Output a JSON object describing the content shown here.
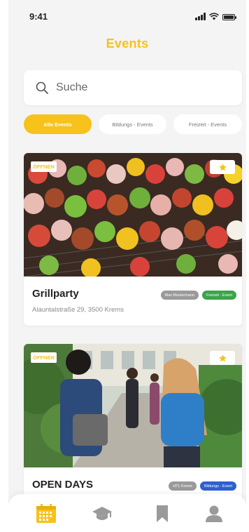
{
  "status": {
    "time": "9:41"
  },
  "header": {
    "title": "Events"
  },
  "search": {
    "placeholder": "Suche"
  },
  "filters": [
    {
      "label": "Alle Events",
      "active": true
    },
    {
      "label": "Bildungs - Events",
      "active": false
    },
    {
      "label": "Freizeit - Events",
      "active": false
    }
  ],
  "events": [
    {
      "status_label": "ÖFFNEN",
      "title": "Grillparty",
      "address": "Alauntalstraße 29, 3500 Krems",
      "tags": [
        {
          "label": "Max Mustermann",
          "color": "#9a9a9a"
        },
        {
          "label": "Freizeit - Event",
          "color": "#3aa54a"
        }
      ]
    },
    {
      "status_label": "ÖFFNEN",
      "title": "OPEN DAYS",
      "tags": [
        {
          "label": "HTL Krems",
          "color": "#9a9a9a"
        },
        {
          "label": "Bildungs - Event",
          "color": "#2f5fd0"
        }
      ]
    }
  ],
  "nav": [
    {
      "icon": "calendar-icon",
      "active": true
    },
    {
      "icon": "graduation-cap-icon",
      "active": false
    },
    {
      "icon": "bookmark-icon",
      "active": false
    },
    {
      "icon": "user-icon",
      "active": false
    }
  ],
  "colors": {
    "accent": "#f6c21b",
    "inactive_icon": "#9a9a9a"
  }
}
